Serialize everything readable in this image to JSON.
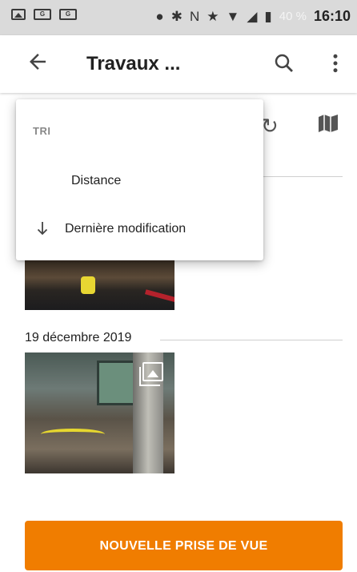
{
  "status_bar": {
    "battery_percent": "40 %",
    "time": "16:10",
    "icons": [
      "image-icon",
      "card-icon",
      "card-icon",
      "location-icon",
      "bluetooth-icon",
      "nfc-icon",
      "star-icon",
      "wifi-icon",
      "signal-icon",
      "battery-icon"
    ]
  },
  "app_bar": {
    "title": "Travaux ...",
    "back_icon": "arrow-left-icon",
    "search_icon": "search-icon",
    "more_icon": "more-vert-icon"
  },
  "toolbar": {
    "refresh_icon": "refresh-icon",
    "map_icon": "map-icon"
  },
  "sort_menu": {
    "header": "TRI",
    "items": [
      {
        "label": "Distance",
        "selected": false
      },
      {
        "label": "Dernière modification",
        "selected": true,
        "direction_icon": "arrow-down-icon"
      }
    ]
  },
  "groups": [
    {
      "date": "",
      "photo_count": 1
    },
    {
      "date": "19 décembre 2019",
      "photo_count": 1,
      "multi_photo_badge": true
    }
  ],
  "cta": {
    "label": "NOUVELLE PRISE DE VUE",
    "color": "#f07d00"
  }
}
